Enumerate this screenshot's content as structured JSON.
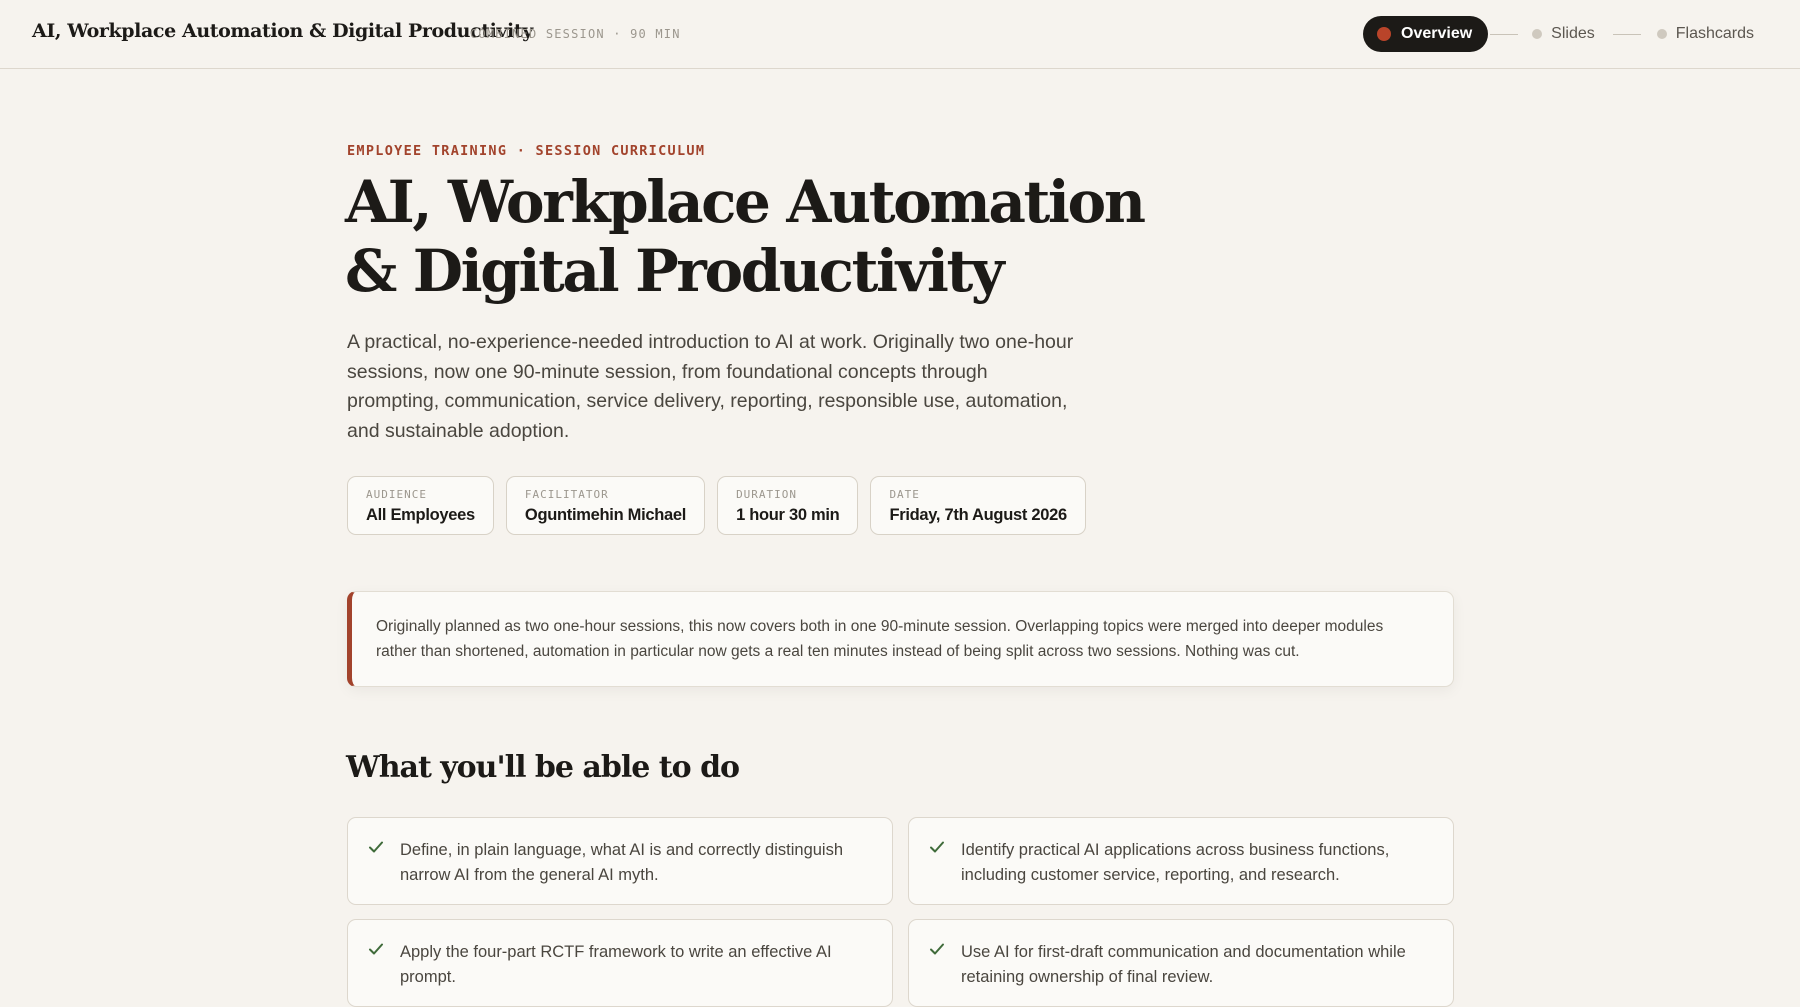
{
  "header": {
    "brand": "AI, Workplace Automation & Digital Productivity",
    "meta": "COMBINED SESSION · 90 MIN",
    "nav": [
      {
        "label": "Overview",
        "active": true
      },
      {
        "label": "Slides",
        "active": false
      },
      {
        "label": "Flashcards",
        "active": false
      }
    ]
  },
  "hero": {
    "eyebrow": "EMPLOYEE TRAINING · SESSION CURRICULUM",
    "title_line1": "AI, Workplace Automation",
    "title_line2": "& Digital Productivity",
    "intro": "A practical, no-experience-needed introduction to AI at work. Originally two one-hour sessions, now one 90-minute session, from foundational concepts through prompting, communication, service delivery, reporting, responsible use, automation, and sustainable adoption."
  },
  "details": [
    {
      "label": "AUDIENCE",
      "value": "All Employees"
    },
    {
      "label": "FACILITATOR",
      "value": "Oguntimehin Michael"
    },
    {
      "label": "DURATION",
      "value": "1 hour 30 min"
    },
    {
      "label": "DATE",
      "value": "Friday, 7th August 2026"
    }
  ],
  "note": "Originally planned as two one-hour sessions, this now covers both in one 90-minute session. Overlapping topics were merged into deeper modules rather than shortened, automation in particular now gets a real ten minutes instead of being split across two sessions. Nothing was cut.",
  "outcomes": {
    "title": "What you'll be able to do",
    "items": [
      "Define, in plain language, what AI is and correctly distinguish narrow AI from the general AI myth.",
      "Identify practical AI applications across business functions, including customer service, reporting, and research.",
      "Apply the four-part RCTF framework to write an effective AI prompt.",
      "Use AI for first-draft communication and documentation while retaining ownership of final review."
    ]
  },
  "colors": {
    "accent": "#a2432c",
    "background": "#f6f3ee",
    "nav_active_bg": "#1c1a17",
    "check": "#3f6b3a"
  },
  "icons": {
    "active_dot": "red-dot-icon",
    "inactive_dot": "grey-dot-icon",
    "outcome_check": "check-icon"
  }
}
